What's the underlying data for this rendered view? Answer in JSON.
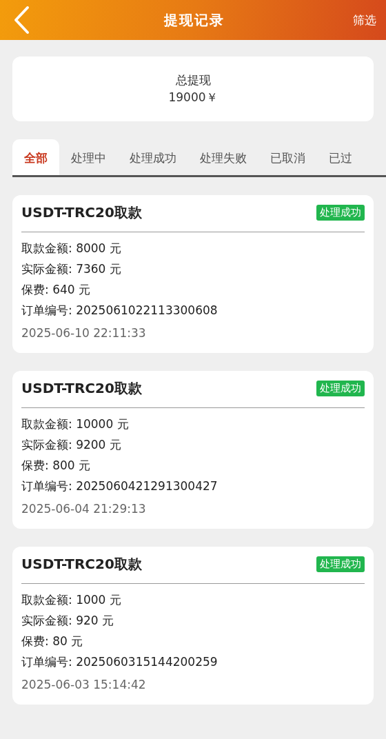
{
  "header": {
    "title": "提现记录",
    "action": "筛选"
  },
  "summary": {
    "label": "总提现",
    "value": "19000￥"
  },
  "tabs": [
    {
      "label": "全部",
      "selected": true
    },
    {
      "label": "处理中",
      "selected": false
    },
    {
      "label": "处理成功",
      "selected": false
    },
    {
      "label": "处理失败",
      "selected": false
    },
    {
      "label": "已取消",
      "selected": false
    },
    {
      "label": "已过",
      "selected": false
    }
  ],
  "records": [
    {
      "title": "USDT-TRC20取款",
      "status": "处理成功",
      "kind": "success",
      "lines": [
        "取款金额: 8000 元",
        "实际金额: 7360 元",
        "保费: 640 元",
        "订单编号: 2025061022113300608"
      ],
      "time": "2025-06-10 22:11:33"
    },
    {
      "title": "USDT-TRC20取款",
      "status": "处理成功",
      "kind": "success",
      "lines": [
        "取款金额: 10000 元",
        "实际金额: 9200 元",
        "保费: 800 元",
        "订单编号: 2025060421291300427"
      ],
      "time": "2025-06-04 21:29:13"
    },
    {
      "title": "USDT-TRC20取款",
      "status": "处理成功",
      "kind": "success",
      "lines": [
        "取款金额: 1000 元",
        "实际金额: 920 元",
        "保费: 80 元",
        "订单编号: 2025060315144200259"
      ],
      "time": "2025-06-03 15:14:42"
    }
  ]
}
